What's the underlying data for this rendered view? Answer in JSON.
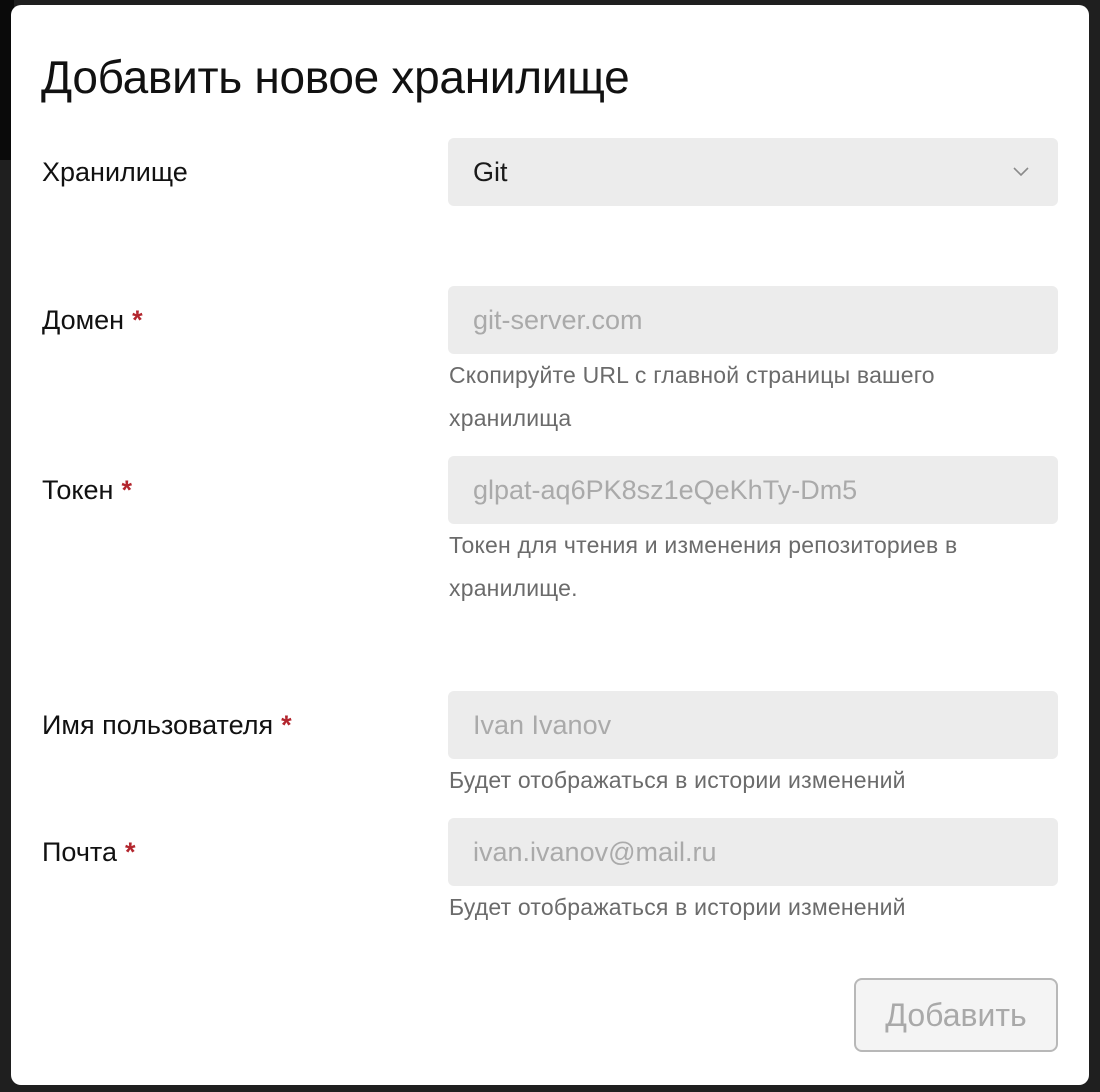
{
  "modal": {
    "title": "Добавить новое хранилище"
  },
  "fields": {
    "storage": {
      "label": "Хранилище",
      "value": "Git",
      "icon": "chevron-down-icon"
    },
    "domain": {
      "label": "Домен",
      "required_mark": "*",
      "placeholder": "git-server.com",
      "hint": "Скопируйте URL с главной страницы вашего хранилища"
    },
    "token": {
      "label": "Токен",
      "required_mark": "*",
      "placeholder": "glpat-aq6PK8sz1eQeKhTy-Dm5",
      "hint": "Токен для чтения и изменения репозиториев в хранилище."
    },
    "username": {
      "label": "Имя пользователя",
      "required_mark": "*",
      "placeholder": "Ivan Ivanov",
      "hint": "Будет отображаться в истории изменений"
    },
    "email": {
      "label": "Почта",
      "required_mark": "*",
      "placeholder": "ivan.ivanov@mail.ru",
      "hint": "Будет отображаться в истории изменений"
    }
  },
  "actions": {
    "submit_label": "Добавить"
  },
  "colors": {
    "required_mark": "#b3262e",
    "field_background": "#ececec",
    "placeholder_text": "#aaaaaa",
    "hint_text": "#6b6b6b",
    "disabled_button_text": "#a9a9a9"
  }
}
